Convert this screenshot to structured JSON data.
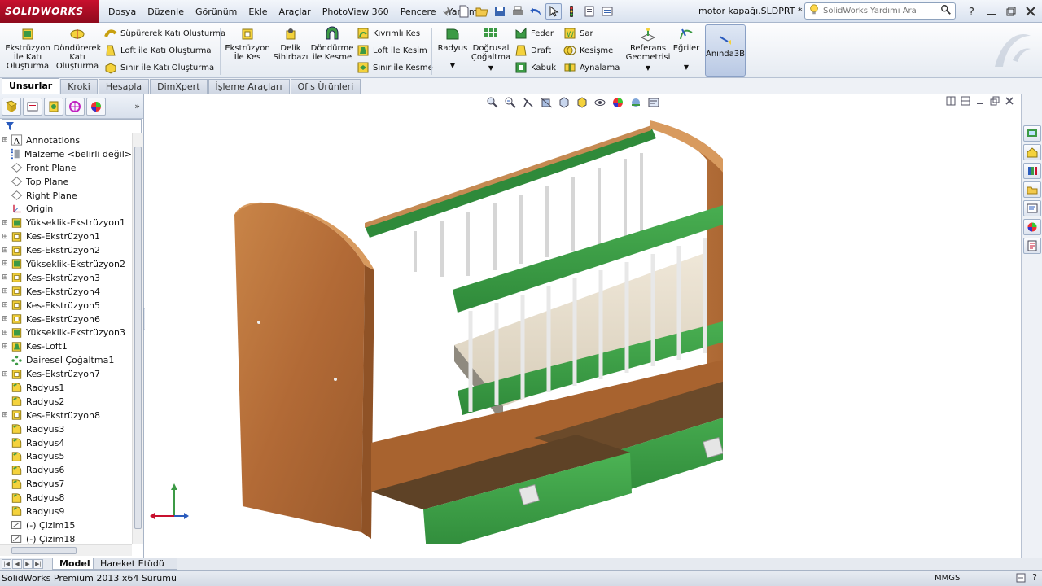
{
  "app": {
    "logo": "SOLIDWORKS",
    "menus": [
      "Dosya",
      "Düzenle",
      "Görünüm",
      "Ekle",
      "Araçlar",
      "PhotoView 360",
      "Pencere",
      "Yardım"
    ],
    "document_title": "motor kapağı.SLDPRT *",
    "help_search_placeholder": "SolidWorks Yardımı Ara"
  },
  "commands": {
    "extrude_boss": "Ekstrüzyon İle Katı Oluşturma",
    "revolve_boss": "Döndürerek Katı Oluşturma",
    "swept_boss": "Süpürerek Katı Oluşturma",
    "loft_boss": "Loft ile Katı Oluşturma",
    "boundary_boss": "Sınır ile Katı Oluşturma",
    "extrude_cut": "Ekstrüzyon İle Kes",
    "hole_wizard": "Delik Sihirbazı",
    "revolve_cut": "Döndürme ile Kesme",
    "swept_cut": "Kıvrımlı Kes",
    "loft_cut": "Loft ile Kesim",
    "boundary_cut": "Sınır ile Kesme",
    "fillet": "Radyus",
    "linear_pattern": "Doğrusal Çoğaltma",
    "rib": "Feder",
    "draft": "Draft",
    "shell": "Kabuk",
    "wrap": "Sar",
    "intersect": "Kesişme",
    "mirror": "Aynalama",
    "ref_geometry": "Referans Geometrisi",
    "curves": "Eğriler",
    "instant3d": "Anında3B"
  },
  "tabs": [
    "Unsurlar",
    "Kroki",
    "Hesapla",
    "DimXpert",
    "İşleme Araçları",
    "Ofis Ürünleri"
  ],
  "tree": [
    {
      "label": "Annotations",
      "icon": "annotations-icon",
      "exp": true
    },
    {
      "label": "Malzeme <belirli değil>",
      "icon": "material-icon",
      "exp": false
    },
    {
      "label": "Front Plane",
      "icon": "plane-icon",
      "exp": false
    },
    {
      "label": "Top Plane",
      "icon": "plane-icon",
      "exp": false
    },
    {
      "label": "Right Plane",
      "icon": "plane-icon",
      "exp": false
    },
    {
      "label": "Origin",
      "icon": "origin-icon",
      "exp": false
    },
    {
      "label": "Yükseklik-Ekstrüzyon1",
      "icon": "boss-extrude-icon",
      "exp": true
    },
    {
      "label": "Kes-Ekstrüzyon1",
      "icon": "cut-extrude-icon",
      "exp": true
    },
    {
      "label": "Kes-Ekstrüzyon2",
      "icon": "cut-extrude-icon",
      "exp": true
    },
    {
      "label": "Yükseklik-Ekstrüzyon2",
      "icon": "boss-extrude-icon",
      "exp": true
    },
    {
      "label": "Kes-Ekstrüzyon3",
      "icon": "cut-extrude-icon",
      "exp": true
    },
    {
      "label": "Kes-Ekstrüzyon4",
      "icon": "cut-extrude-icon",
      "exp": true
    },
    {
      "label": "Kes-Ekstrüzyon5",
      "icon": "cut-extrude-icon",
      "exp": true
    },
    {
      "label": "Kes-Ekstrüzyon6",
      "icon": "cut-extrude-icon",
      "exp": true
    },
    {
      "label": "Yükseklik-Ekstrüzyon3",
      "icon": "boss-extrude-icon",
      "exp": true
    },
    {
      "label": "Kes-Loft1",
      "icon": "cut-loft-icon",
      "exp": true
    },
    {
      "label": "Dairesel Çoğaltma1",
      "icon": "circular-pattern-icon",
      "exp": false
    },
    {
      "label": "Kes-Ekstrüzyon7",
      "icon": "cut-extrude-icon",
      "exp": true
    },
    {
      "label": "Radyus1",
      "icon": "fillet-icon",
      "exp": false
    },
    {
      "label": "Radyus2",
      "icon": "fillet-icon",
      "exp": false
    },
    {
      "label": "Kes-Ekstrüzyon8",
      "icon": "cut-extrude-icon",
      "exp": true
    },
    {
      "label": "Radyus3",
      "icon": "fillet-icon",
      "exp": false
    },
    {
      "label": "Radyus4",
      "icon": "fillet-icon",
      "exp": false
    },
    {
      "label": "Radyus5",
      "icon": "fillet-icon",
      "exp": false
    },
    {
      "label": "Radyus6",
      "icon": "fillet-icon",
      "exp": false
    },
    {
      "label": "Radyus7",
      "icon": "fillet-icon",
      "exp": false
    },
    {
      "label": "Radyus8",
      "icon": "fillet-icon",
      "exp": false
    },
    {
      "label": "Radyus9",
      "icon": "fillet-icon",
      "exp": false
    },
    {
      "label": "(-) Çizim15",
      "icon": "sketch-icon",
      "exp": false
    },
    {
      "label": "(-) Çizim18",
      "icon": "sketch-icon",
      "exp": false
    }
  ],
  "bottom_tabs": {
    "model": "Model",
    "motion": "Hareket Etüdü 1"
  },
  "status": {
    "text": "SolidWorks Premium 2013 x64 Sürümü",
    "units": "MMGS"
  },
  "colors": {
    "brand": "#c8102e",
    "wood": "#b26a36",
    "green": "#3c9a45",
    "accent": "#2a5bbd"
  }
}
